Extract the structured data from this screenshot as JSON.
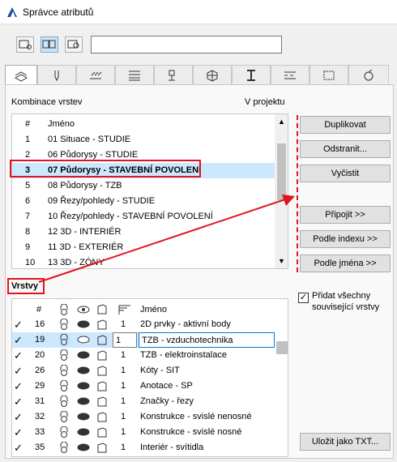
{
  "window": {
    "title": "Správce atributů"
  },
  "toolbar": {
    "search_value": ""
  },
  "tabs": [
    "layer-comb",
    "pen",
    "fill",
    "composite",
    "surface",
    "building-material",
    "profile",
    "line",
    "zone"
  ],
  "combos": {
    "section_label": "Kombinace vrstev",
    "in_project_label": "V projektu",
    "col_num": "#",
    "col_name": "Jméno",
    "rows": [
      {
        "num": "1",
        "name": "01 Situace - STUDIE"
      },
      {
        "num": "2",
        "name": "06 Půdorysy - STUDIE"
      },
      {
        "num": "3",
        "name": "07 Půdorysy - STAVEBNÍ POVOLENÍ"
      },
      {
        "num": "5",
        "name": "08 Půdorysy - TZB"
      },
      {
        "num": "6",
        "name": "09 Řezy/pohledy - STUDIE"
      },
      {
        "num": "7",
        "name": "10 Řezy/pohledy - STAVEBNÍ POVOLENÍ"
      },
      {
        "num": "8",
        "name": "12 3D - INTERIÉR"
      },
      {
        "num": "9",
        "name": "11 3D - EXTERIÉR"
      },
      {
        "num": "10",
        "name": "13 3D - ZÓNY"
      }
    ]
  },
  "buttons": {
    "duplicate": "Duplikovat",
    "remove": "Odstranit...",
    "clean": "Vyčistit",
    "attach": "Připojit >>",
    "by_index": "Podle indexu >>",
    "by_name": "Podle jména >>",
    "save_txt": "Uložit jako TXT..."
  },
  "layers": {
    "section_label": "Vrstvy",
    "col_num": "#",
    "col_name": "Jméno",
    "add_related_label": "Přidat všechny související vrstvy",
    "add_related_checked": true,
    "rows": [
      {
        "num": "16",
        "pen": "1",
        "name": "2D prvky - aktivní body"
      },
      {
        "num": "19",
        "pen": "1",
        "name": "TZB - vzduchotechnika"
      },
      {
        "num": "20",
        "pen": "1",
        "name": "TZB - elektroinstalace"
      },
      {
        "num": "26",
        "pen": "1",
        "name": "Kóty - SIT"
      },
      {
        "num": "29",
        "pen": "1",
        "name": "Anotace - SP"
      },
      {
        "num": "31",
        "pen": "1",
        "name": "Značky - řezy"
      },
      {
        "num": "32",
        "pen": "1",
        "name": "Konstrukce - svislé nenosné"
      },
      {
        "num": "33",
        "pen": "1",
        "name": "Konstrukce - svislé nosné"
      },
      {
        "num": "35",
        "pen": "1",
        "name": "Interiér - svítidla"
      }
    ]
  },
  "colors": {
    "accent": "#e0141e",
    "selection": "#cce8ff"
  }
}
